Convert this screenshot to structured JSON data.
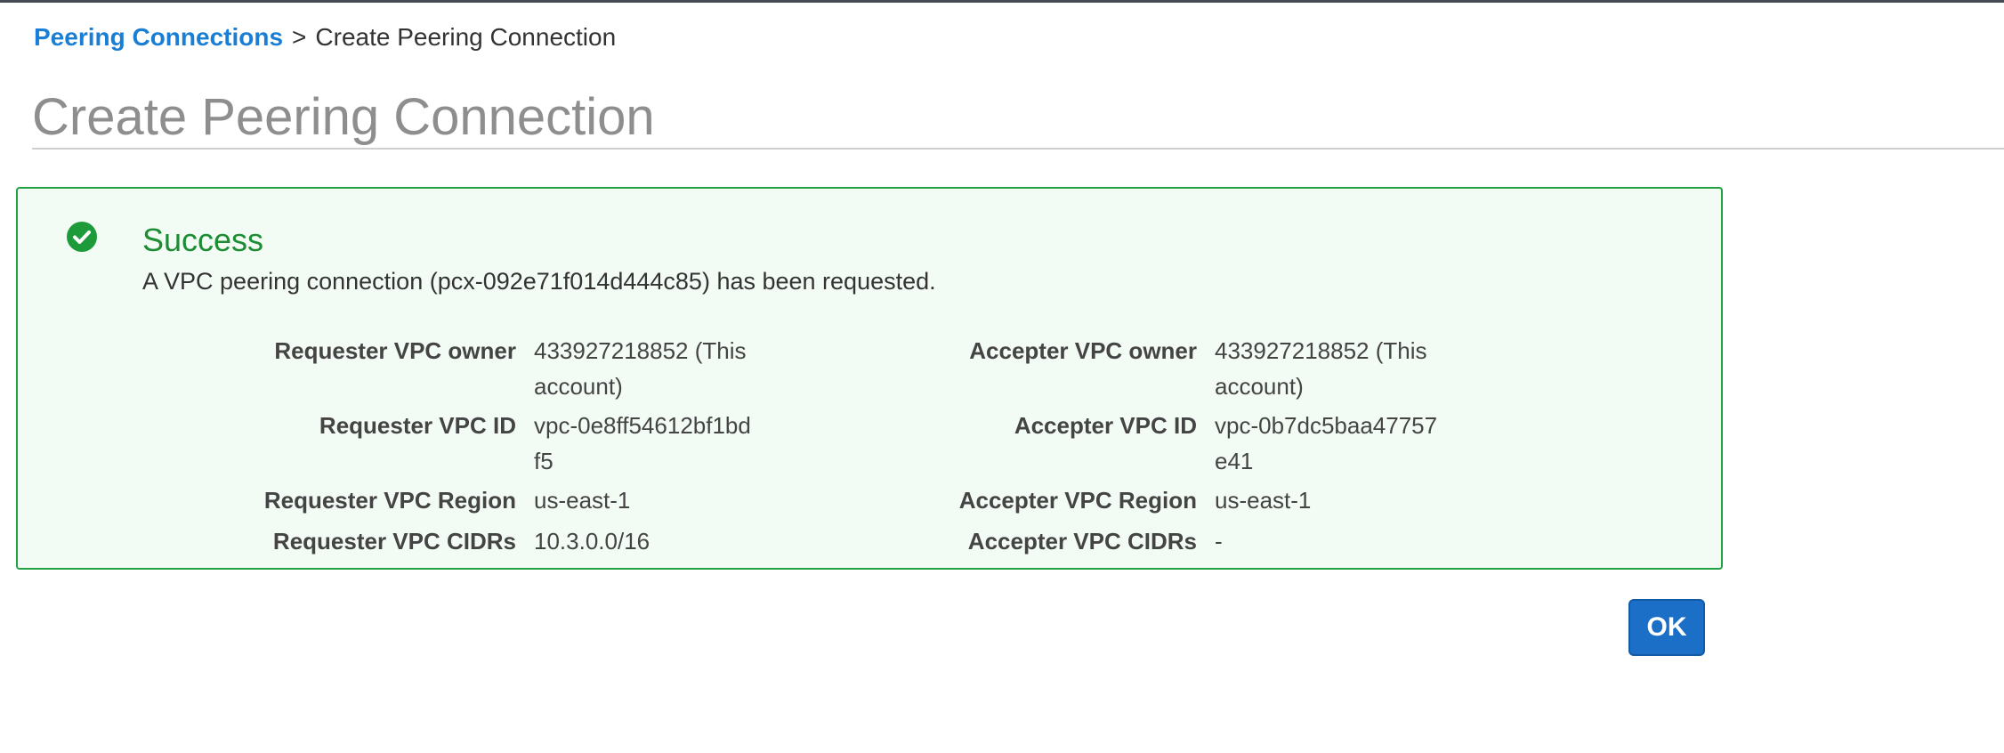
{
  "breadcrumb": {
    "link_label": "Peering Connections",
    "separator": ">",
    "current": "Create Peering Connection"
  },
  "page": {
    "title": "Create Peering Connection"
  },
  "alert": {
    "status": "success",
    "icon": "check-circle-icon",
    "title": "Success",
    "message": "A VPC peering connection (pcx-092e71f014d444c85) has been requested.",
    "color": "#23a143",
    "background": "#f3fbf5"
  },
  "details": {
    "requester": {
      "owner_label": "Requester VPC owner",
      "owner_value": "433927218852 (This account)",
      "id_label": "Requester VPC ID",
      "id_value": "vpc-0e8ff54612bf1bdf5",
      "region_label": "Requester VPC Region",
      "region_value": "us-east-1",
      "cidrs_label": "Requester VPC CIDRs",
      "cidrs_value": "10.3.0.0/16"
    },
    "accepter": {
      "owner_label": "Accepter VPC owner",
      "owner_value": "433927218852 (This account)",
      "id_label": "Accepter VPC ID",
      "id_value": "vpc-0b7dc5baa47757e41",
      "region_label": "Accepter VPC Region",
      "region_value": "us-east-1",
      "cidrs_label": "Accepter VPC CIDRs",
      "cidrs_value": "-"
    }
  },
  "actions": {
    "ok_label": "OK",
    "ok_color": "#1b6fc6"
  }
}
